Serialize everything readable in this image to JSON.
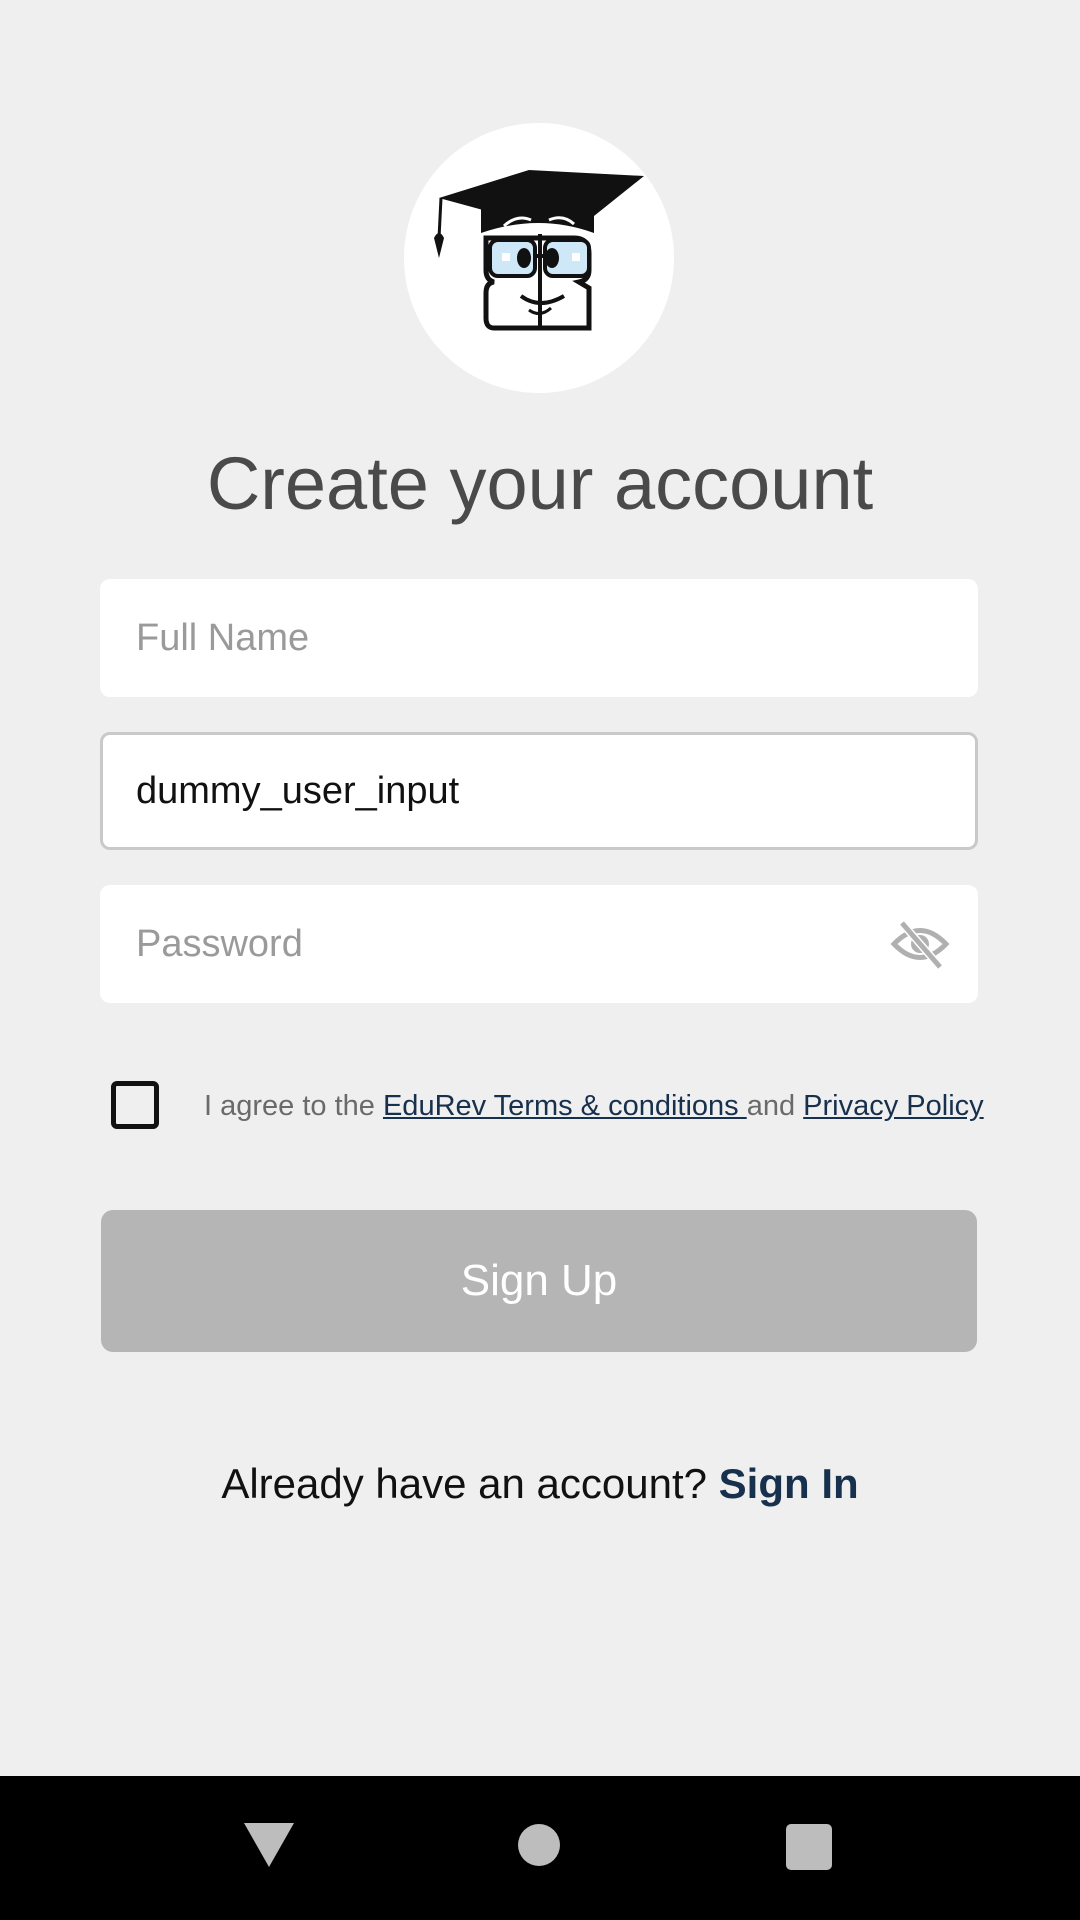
{
  "header": {
    "title": "Create your account",
    "logo_icon": "edurev-mascot-icon"
  },
  "form": {
    "full_name": {
      "placeholder": "Full Name",
      "value": ""
    },
    "username": {
      "placeholder": "",
      "value": "dummy_user_input"
    },
    "password": {
      "placeholder": "Password",
      "value": "",
      "toggle_icon": "eye-off-icon"
    },
    "agreement": {
      "checked": false,
      "prefix": "I agree to the ",
      "terms_link": "EduRev Terms & conditions ",
      "joiner": "and ",
      "privacy_link": "Privacy Policy"
    },
    "signup_label": "Sign Up"
  },
  "footer": {
    "question": "Already have an account? ",
    "signin_label": "Sign In"
  },
  "navbar": {
    "back_icon": "back-triangle-icon",
    "home_icon": "home-circle-icon",
    "recent_icon": "recents-square-icon"
  },
  "colors": {
    "background": "#efefef",
    "link": "#17304d",
    "button_disabled": "#b5b5b5",
    "title": "#4a4a4a"
  }
}
